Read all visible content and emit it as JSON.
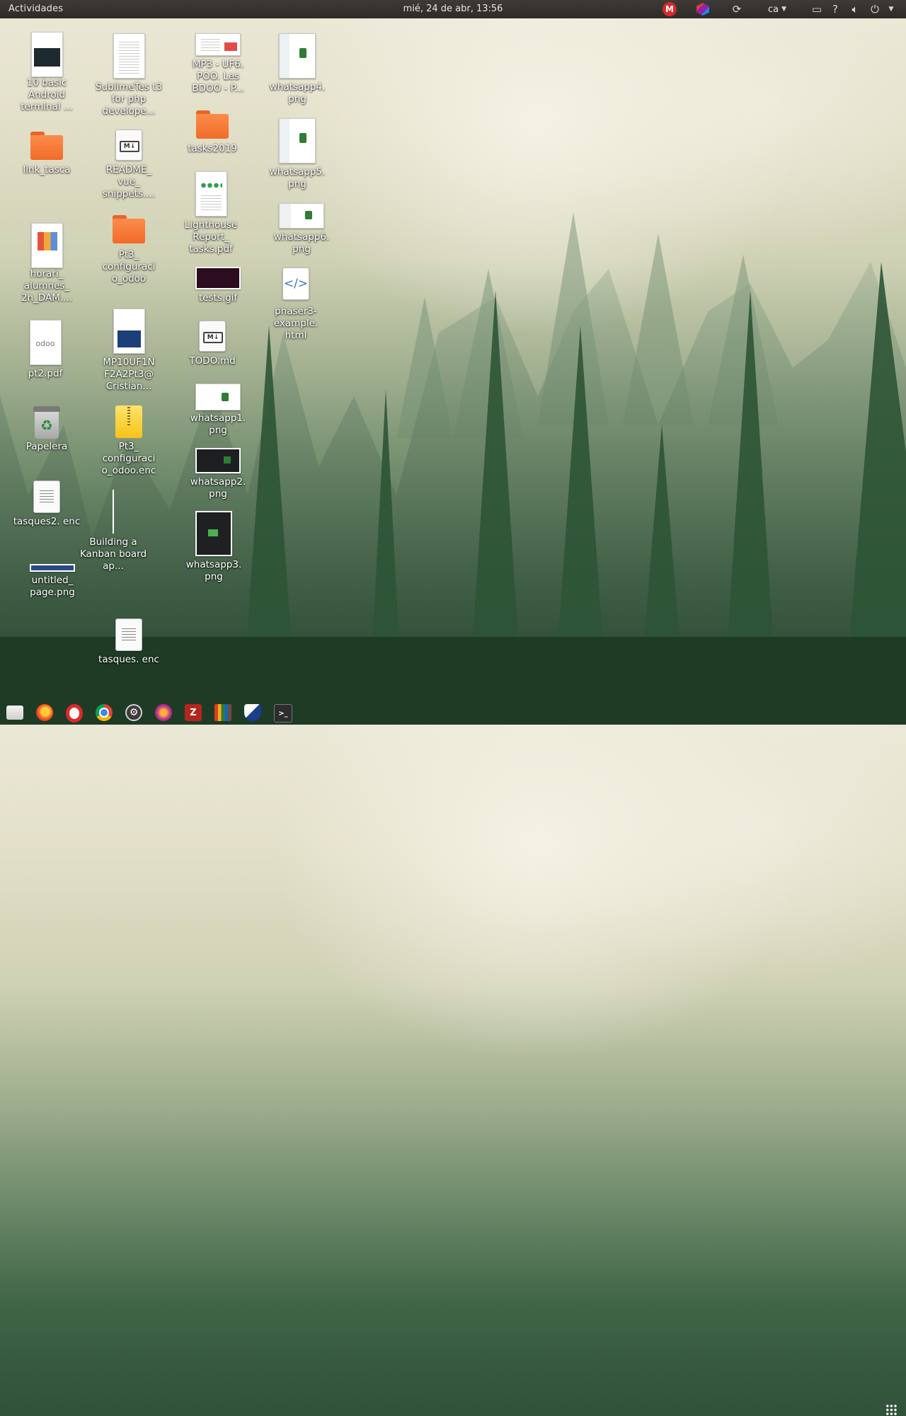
{
  "topbar": {
    "activities": "Actividades",
    "clock": "mié, 24 de abr, 13:56",
    "keyboard_layout": "ca",
    "mega_label": "M",
    "tray_icons": [
      "mega-icon",
      "cube-icon",
      "refresh-icon",
      "keyboard-layout",
      "display-icon",
      "help-icon",
      "volume-icon",
      "power-icon",
      "dropdown-arrow"
    ]
  },
  "desktop": {
    "icons": [
      {
        "label": "10 basic Android terminal ...",
        "type": "image-thumbnail"
      },
      {
        "label": "link_tasca",
        "type": "folder"
      },
      {
        "label": "horari_ alumnes_ 2n_DAM....",
        "type": "image-thumbnail"
      },
      {
        "label": "pt2.pdf",
        "type": "pdf-thumbnail"
      },
      {
        "label": "Papelera",
        "type": "trash"
      },
      {
        "label": "tasques2. enc",
        "type": "encrypted-file"
      },
      {
        "label": "untitled_ page.png",
        "type": "image-thumbnail"
      },
      {
        "label": "SublimeTes t3 for php develope...",
        "type": "document-thumbnail"
      },
      {
        "label": "README_ vue_ snippets....",
        "type": "markdown"
      },
      {
        "label": "Pt3_ configuraci o_odoo",
        "type": "folder"
      },
      {
        "label": "MP10UF1N F2A2Pt3@ Cristian...",
        "type": "pdf-thumbnail"
      },
      {
        "label": "Pt3_ configuraci o_odoo.enc",
        "type": "archive"
      },
      {
        "label": "Building a Kanban board ap...",
        "type": "image-thumbnail"
      },
      {
        "label": "tasques. enc",
        "type": "encrypted-file"
      },
      {
        "label": "MP3 - UF6. POO. Les BDOO - P...",
        "type": "document-thumbnail"
      },
      {
        "label": "tasks2019",
        "type": "folder"
      },
      {
        "label": "Lighthouse Report_ tasks.pdf",
        "type": "pdf-thumbnail"
      },
      {
        "label": "tests.gif",
        "type": "image-thumbnail"
      },
      {
        "label": "TODO.md",
        "type": "markdown"
      },
      {
        "label": "whatsapp1. png",
        "type": "image-thumbnail"
      },
      {
        "label": "whatsapp2. png",
        "type": "image-thumbnail"
      },
      {
        "label": "whatsapp3. png",
        "type": "image-thumbnail"
      },
      {
        "label": "whatsapp4. png",
        "type": "image-thumbnail"
      },
      {
        "label": "whatsapp5. png",
        "type": "image-thumbnail"
      },
      {
        "label": "whatsapp6. png",
        "type": "image-thumbnail"
      },
      {
        "label": "phaser3- example. html",
        "type": "html-file"
      }
    ]
  },
  "dock": {
    "apps": [
      "Files",
      "Firefox",
      "Opera",
      "Chrome",
      "Settings",
      "Firefox Developer",
      "FileZilla",
      "Library",
      "Shield app",
      "Terminal"
    ],
    "terminal_glyph": ">_"
  },
  "colors": {
    "topbar_bg": "#2e2b28",
    "folder_orange": "#f26b29",
    "mega_red": "#d9272e"
  }
}
